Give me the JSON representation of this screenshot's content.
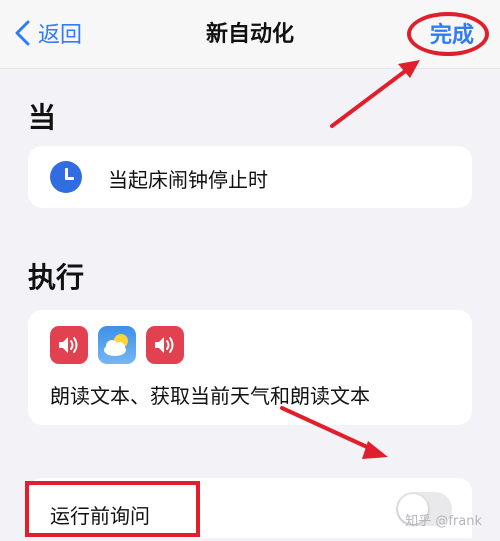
{
  "navbar": {
    "back_label": "返回",
    "title": "新自动化",
    "done_label": "完成"
  },
  "trigger": {
    "section_title": "当",
    "label": "当起床闹钟停止时",
    "icon": "clock-icon"
  },
  "actions": {
    "section_title": "执行",
    "icons": [
      "speaker-icon",
      "weather-icon",
      "speaker-icon"
    ],
    "summary": "朗读文本、获取当前天气和朗读文本"
  },
  "ask_before_running": {
    "label": "运行前询问",
    "enabled": false
  },
  "watermark": "知乎 @frank",
  "colors": {
    "accent": "#2f7cf6",
    "annotation": "#e11f2c",
    "speaker_app": "#e2414f",
    "clock": "#2f6de0"
  }
}
